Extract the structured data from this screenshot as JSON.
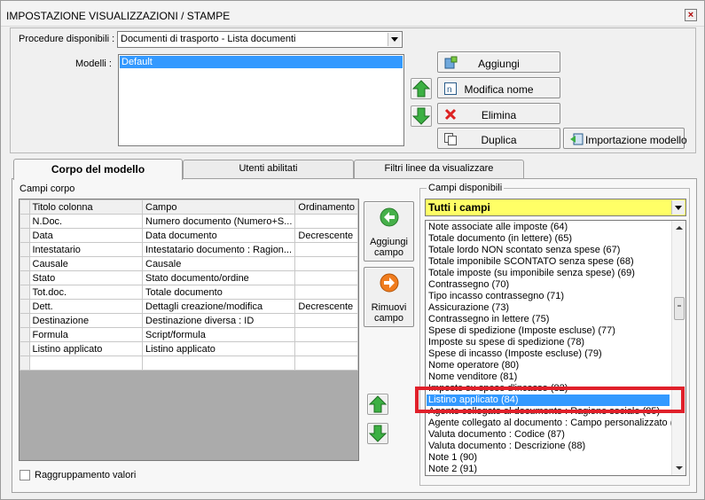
{
  "window": {
    "title": "IMPOSTAZIONE VISUALIZZAZIONI / STAMPE",
    "close_glyph": "×"
  },
  "header": {
    "procedure_label": "Procedure disponibili :",
    "procedure_value": "Documenti di trasporto - Lista documenti",
    "models_label": "Modelli :",
    "models": [
      "Default"
    ]
  },
  "buttons": {
    "add": "Aggiungi",
    "rename": "Modifica nome",
    "delete": "Elimina",
    "duplicate": "Duplica",
    "import": "Importazione modello"
  },
  "tabs": [
    {
      "label": "Corpo del modello",
      "active": true
    },
    {
      "label": "Utenti abilitati",
      "active": false
    },
    {
      "label": "Filtri linee da visualizzare",
      "active": false
    }
  ],
  "body_fields": {
    "label": "Campi corpo",
    "columns": [
      "Titolo colonna",
      "Campo",
      "Ordinamento"
    ],
    "rows": [
      [
        "N.Doc.",
        "Numero documento (Numero+S...",
        ""
      ],
      [
        "Data",
        "Data documento",
        "Decrescente"
      ],
      [
        "Intestatario",
        "Intestatario documento : Ragion...",
        ""
      ],
      [
        "Causale",
        "Causale",
        ""
      ],
      [
        "Stato",
        "Stato documento/ordine",
        ""
      ],
      [
        "Tot.doc.",
        "Totale documento",
        ""
      ],
      [
        "Dett.",
        "Dettagli creazione/modifica",
        "Decrescente"
      ],
      [
        "Destinazione",
        "Destinazione diversa : ID",
        ""
      ],
      [
        "Formula",
        "Script/formula",
        ""
      ],
      [
        "Listino applicato",
        "Listino applicato",
        ""
      ],
      [
        "",
        "",
        ""
      ]
    ]
  },
  "actions": {
    "add_field_line1": "Aggiungi",
    "add_field_line2": "campo",
    "remove_field_line1": "Rimuovi",
    "remove_field_line2": "campo"
  },
  "available": {
    "label": "Campi disponibili",
    "filter_value": "Tutti i campi",
    "items": [
      "Note associate alle imposte (64)",
      "Totale documento (in lettere) (65)",
      "Totale lordo NON scontato senza spese (67)",
      "Totale imponibile SCONTATO senza spese (68)",
      "Totale imposte (su imponibile senza spese) (69)",
      "Contrassegno (70)",
      "Tipo incasso contrassegno (71)",
      "Assicurazione (73)",
      "Contrassegno in lettere (75)",
      "Spese di spedizione (Imposte escluse) (77)",
      "Imposte su spese di spedizione (78)",
      "Spese di incasso (Imposte escluse) (79)",
      "Nome operatore (80)",
      "Nome venditore (81)",
      "Imposte su spese d'incasso (82)",
      "Listino applicato (84)",
      "Agente collegato al documento : Ragione sociale (85)",
      "Agente collegato al documento : Campo personalizzato (sc",
      "Valuta documento : Codice (87)",
      "Valuta documento : Descrizione (88)",
      "Note 1 (90)",
      "Note 2 (91)"
    ],
    "highlighted_index": 15
  },
  "footer": {
    "grouping_label": "Raggruppamento valori",
    "grouping_checked": false
  },
  "colors": {
    "selection": "#3399ff",
    "filter_bg": "#ffff66",
    "highlight_box": "#e0202a"
  }
}
